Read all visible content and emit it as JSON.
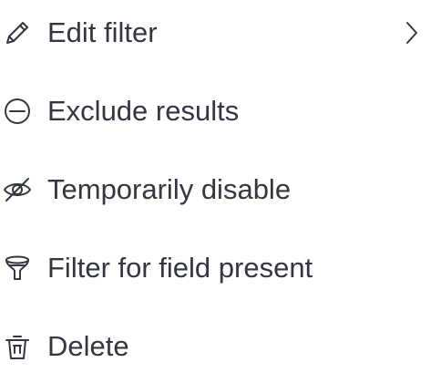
{
  "menu": {
    "items": [
      {
        "label": "Edit filter",
        "icon": "pencil-icon",
        "has_submenu": true
      },
      {
        "label": "Exclude results",
        "icon": "minus-circle-icon"
      },
      {
        "label": "Temporarily disable",
        "icon": "eye-closed-icon"
      },
      {
        "label": "Filter for field present",
        "icon": "funnel-icon"
      },
      {
        "label": "Delete",
        "icon": "trash-icon"
      }
    ]
  },
  "colors": {
    "text": "#343741",
    "background": "#ffffff"
  }
}
